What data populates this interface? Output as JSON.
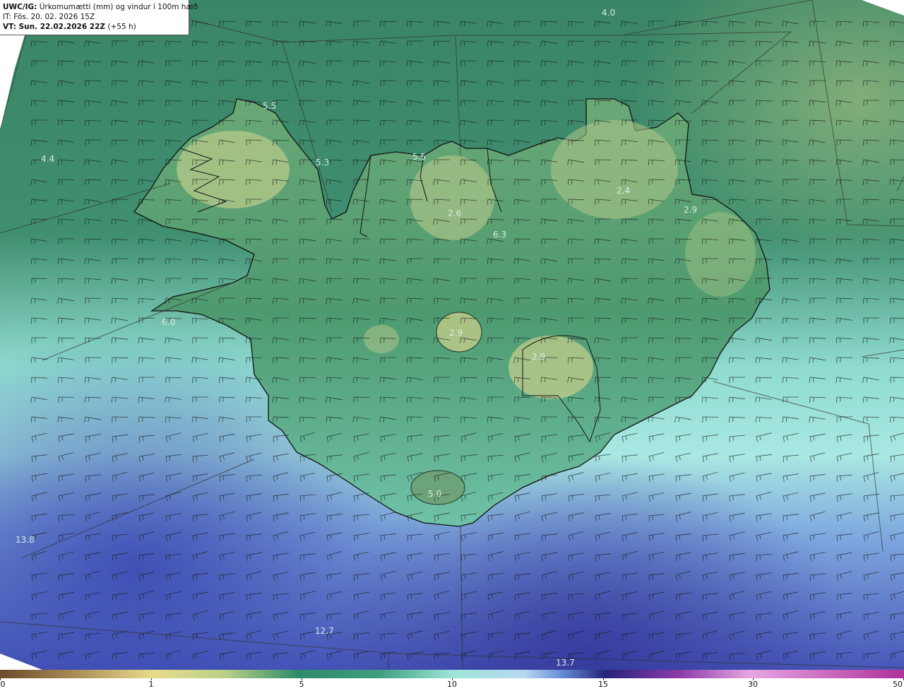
{
  "header": {
    "title_code": "UWC/IG:",
    "title_text": " Úrkomumætti (mm) og vindur í 100m hæð",
    "it_line": "IT: Fös. 20. 02. 2026 15Z",
    "vt_prefix": "VT: Sun. 22.02.2026 22Z",
    "vt_suffix": " (+55 h)"
  },
  "map_labels": [
    "4.0",
    "5.5",
    "4.4",
    "5.3",
    "5.5",
    "2.4",
    "2.9",
    "2.6",
    "6.3",
    "6.0",
    "2.9",
    "2.9",
    "5.0",
    "13.8",
    "12.7",
    "13.7"
  ],
  "colorbar": {
    "ticks": [
      "0",
      "1",
      "5",
      "10",
      "15",
      "30",
      "50"
    ],
    "colors": [
      "#6b4a2a",
      "#a88a55",
      "#e8dc8a",
      "#d8e08a",
      "#7fbd7f",
      "#2e8a6a",
      "#45a58a",
      "#9ee5d8",
      "#c8f2ee",
      "#8fb8e8",
      "#4a63c0",
      "#24237a",
      "#8a3aa8",
      "#e7a6e2",
      "#b0309a"
    ]
  },
  "colors": {
    "sea_north": "#3f8a6a",
    "sea_south": "#5b86cf",
    "land_low": "#3d8b66",
    "land_high": "#b9c988",
    "coastline": "#111111",
    "barb": "#1a1a1a"
  }
}
